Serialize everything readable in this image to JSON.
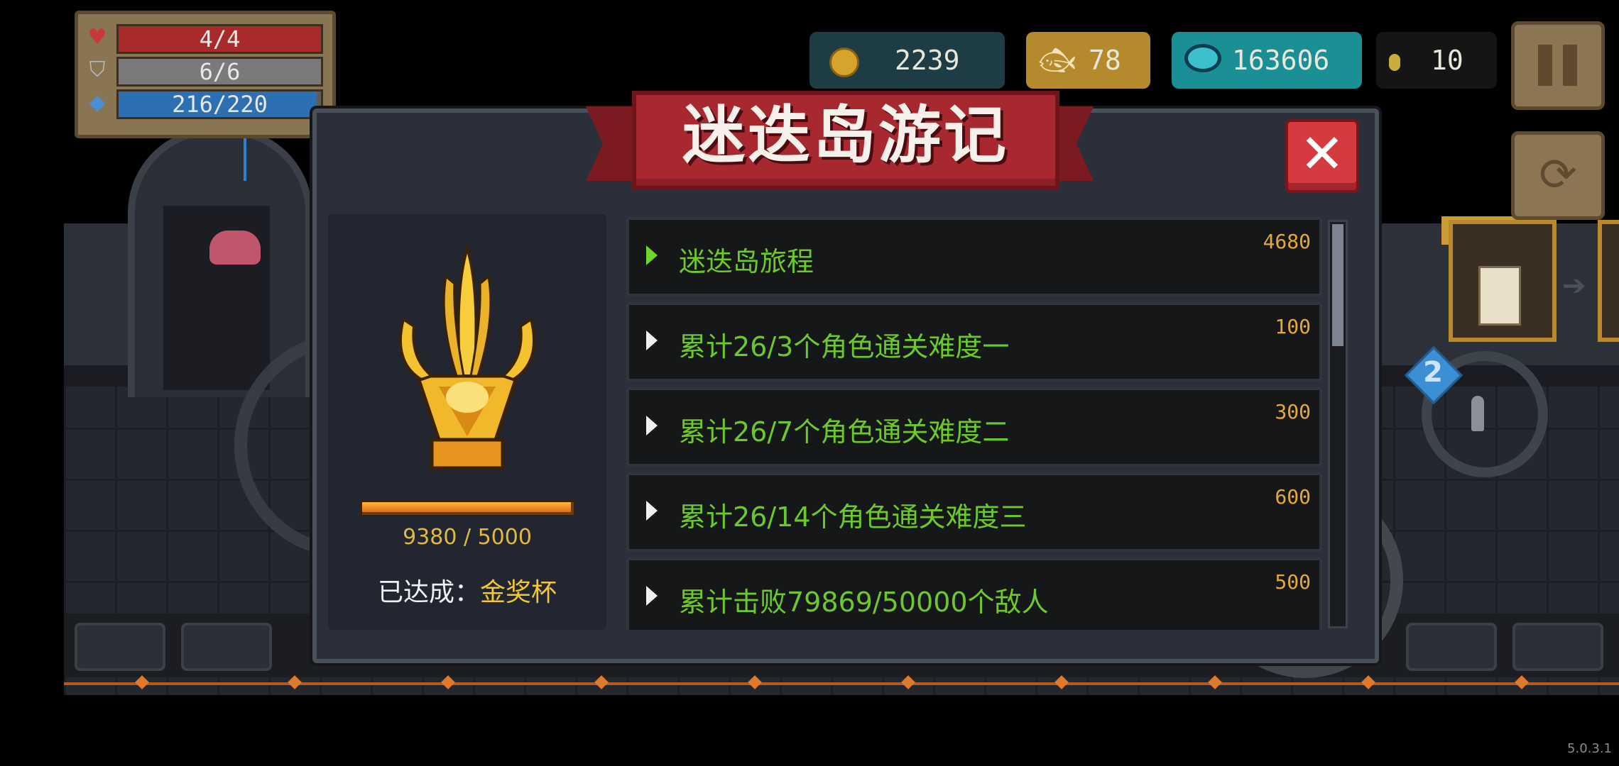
{
  "hud": {
    "health": "4/4",
    "armor": "6/6",
    "energy": "216/220",
    "health_fill": 1.0,
    "armor_fill": 1.0,
    "energy_fill": 0.98
  },
  "resources": {
    "gold": "2239",
    "fish": "78",
    "gems": "163606",
    "seeds": "10"
  },
  "weapon": {
    "slot": "2"
  },
  "version": "5.0.3.1",
  "dialog": {
    "title": "迷迭岛游记",
    "progress_text": "9380 / 5000",
    "progress_fill": 1.0,
    "achieved_label": "已达成：",
    "achieved_value": "金奖杯",
    "items": [
      {
        "label": "迷迭岛旅程",
        "points": "4680"
      },
      {
        "label": "累计26/3个角色通关难度一",
        "points": "100"
      },
      {
        "label": "累计26/7个角色通关难度二",
        "points": "300"
      },
      {
        "label": "累计26/14个角色通关难度三",
        "points": "600"
      },
      {
        "label": "累计击败79869/50000个敌人",
        "points": "500"
      }
    ]
  },
  "colors": {
    "health": "#a82a2a",
    "armor": "#7a7a7a",
    "energy": "#2c6fb3",
    "banner": "#a82830",
    "item_text": "#6cc92c",
    "points": "#e4a93a"
  }
}
